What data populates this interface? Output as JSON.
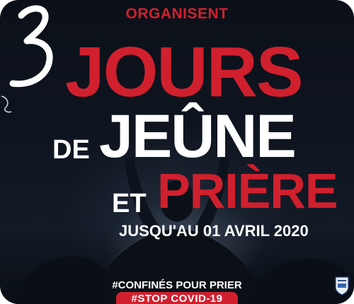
{
  "poster": {
    "organizer_text": "ORGANISENT",
    "numeral": "3",
    "line1": "JOURS",
    "line2_prefix": "DE",
    "line2": "JEÛNE",
    "line3_prefix": "ET",
    "line3": "PRIÈRE",
    "date_line": "JUSQU'AU 01 AVRIL 2020",
    "hashtag1": "#CONFINÉS POUR PRIER",
    "hashtag2": "#STOP COVID-19"
  },
  "colors": {
    "accent": "#d0202e",
    "background": "#0f1520",
    "text": "#ffffff"
  },
  "icons": [
    "logo-emblem-icon",
    "signature-mark-icon"
  ]
}
